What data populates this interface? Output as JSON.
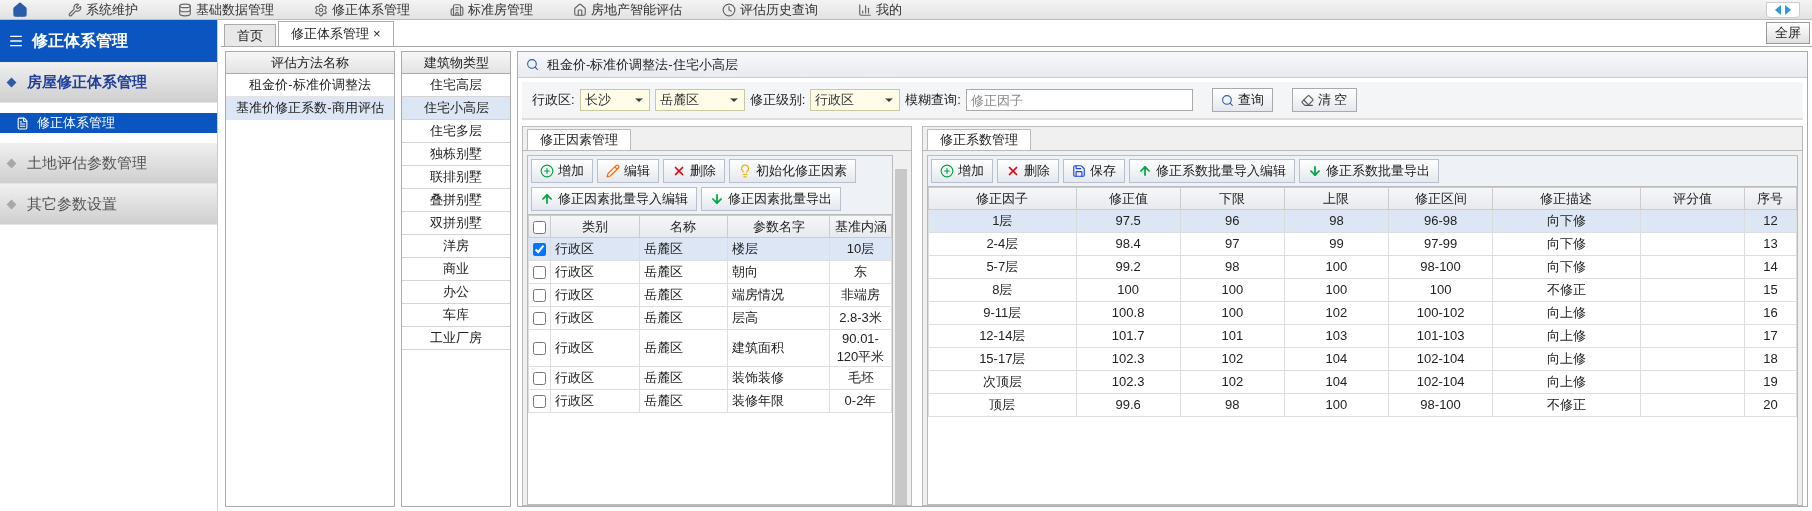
{
  "top_nav": [
    {
      "label": "系统维护"
    },
    {
      "label": "基础数据管理"
    },
    {
      "label": "修正体系管理"
    },
    {
      "label": "标准房管理"
    },
    {
      "label": "房地产智能评估"
    },
    {
      "label": "评估历史查询"
    },
    {
      "label": "我的"
    }
  ],
  "sidebar": {
    "title": "修正体系管理",
    "groups": [
      {
        "label": "房屋修正体系管理",
        "expanded": true,
        "items": [
          {
            "label": "修正体系管理",
            "selected": true
          }
        ]
      },
      {
        "label": "土地评估参数管理",
        "expanded": false
      },
      {
        "label": "其它参数设置",
        "expanded": false
      }
    ]
  },
  "tabs": [
    {
      "label": "首页",
      "selected": false,
      "closable": false
    },
    {
      "label": "修正体系管理",
      "selected": true,
      "closable": true,
      "close": "×"
    }
  ],
  "fullscreen_button": "全屏",
  "methods": {
    "header": "评估方法名称",
    "items": [
      {
        "label": "租金价-标准价调整法",
        "selected": false
      },
      {
        "label": "基准价修正系数-商用评估",
        "selected": true
      }
    ]
  },
  "building_types": {
    "header": "建筑物类型",
    "items": [
      {
        "label": "住宅高层",
        "selected": false
      },
      {
        "label": "住宅小高层",
        "selected": true
      },
      {
        "label": "住宅多层",
        "selected": false
      },
      {
        "label": "独栋别墅",
        "selected": false
      },
      {
        "label": "联排别墅",
        "selected": false
      },
      {
        "label": "叠拼别墅",
        "selected": false
      },
      {
        "label": "双拼别墅",
        "selected": false
      },
      {
        "label": "洋房",
        "selected": false
      },
      {
        "label": "商业",
        "selected": false
      },
      {
        "label": "办公",
        "selected": false
      },
      {
        "label": "车库",
        "selected": false
      },
      {
        "label": "工业厂房",
        "selected": false
      }
    ]
  },
  "panel_title": "租金价-标准价调整法-住宅小高层",
  "filters": {
    "region_label": "行政区:",
    "city": "长沙",
    "district": "岳麓区",
    "level_label": "修正级别:",
    "level": "行政区",
    "fuzzy_label": "模糊查询:",
    "fuzzy_placeholder": "修正因子",
    "search_button": "查询",
    "clear_button": "清 空"
  },
  "factors": {
    "tab": "修正因素管理",
    "buttons": [
      {
        "kind": "add",
        "label": "增加"
      },
      {
        "kind": "edit",
        "label": "编辑"
      },
      {
        "kind": "delete",
        "label": "删除"
      },
      {
        "kind": "bulb",
        "label": "初始化修正因素"
      },
      {
        "kind": "import",
        "label": "修正因素批量导入编辑"
      },
      {
        "kind": "export",
        "label": "修正因素批量导出"
      }
    ],
    "all_checked": false,
    "columns": [
      "类别",
      "名称",
      "参数名字",
      "基准内涵"
    ],
    "rows": [
      {
        "checked": true,
        "selected": true,
        "cells": [
          "行政区",
          "岳麓区",
          "楼层",
          "10层"
        ]
      },
      {
        "checked": false,
        "selected": false,
        "cells": [
          "行政区",
          "岳麓区",
          "朝向",
          "东"
        ]
      },
      {
        "checked": false,
        "selected": false,
        "cells": [
          "行政区",
          "岳麓区",
          "端房情况",
          "非端房"
        ]
      },
      {
        "checked": false,
        "selected": false,
        "cells": [
          "行政区",
          "岳麓区",
          "层高",
          "2.8-3米"
        ]
      },
      {
        "checked": false,
        "selected": false,
        "cells": [
          "行政区",
          "岳麓区",
          "建筑面积",
          "90.01-120平米"
        ]
      },
      {
        "checked": false,
        "selected": false,
        "cells": [
          "行政区",
          "岳麓区",
          "装饰装修",
          "毛坯"
        ]
      },
      {
        "checked": false,
        "selected": false,
        "cells": [
          "行政区",
          "岳麓区",
          "装修年限",
          "0-2年"
        ]
      }
    ]
  },
  "coefficients": {
    "tab": "修正系数管理",
    "buttons": [
      {
        "kind": "add",
        "label": "增加"
      },
      {
        "kind": "delete",
        "label": "删除"
      },
      {
        "kind": "save",
        "label": "保存"
      },
      {
        "kind": "import",
        "label": "修正系数批量导入编辑"
      },
      {
        "kind": "export",
        "label": "修正系数批量导出"
      }
    ],
    "columns": [
      "修正因子",
      "修正值",
      "下限",
      "上限",
      "修正区间",
      "修正描述",
      "评分值",
      "序号"
    ],
    "rows": [
      {
        "selected": true,
        "cells": [
          "1层",
          "97.5",
          "96",
          "98",
          "96-98",
          "向下修",
          "",
          "12"
        ]
      },
      {
        "selected": false,
        "cells": [
          "2-4层",
          "98.4",
          "97",
          "99",
          "97-99",
          "向下修",
          "",
          "13"
        ]
      },
      {
        "selected": false,
        "cells": [
          "5-7层",
          "99.2",
          "98",
          "100",
          "98-100",
          "向下修",
          "",
          "14"
        ]
      },
      {
        "selected": false,
        "cells": [
          "8层",
          "100",
          "100",
          "100",
          "100",
          "不修正",
          "",
          "15"
        ]
      },
      {
        "selected": false,
        "cells": [
          "9-11层",
          "100.8",
          "100",
          "102",
          "100-102",
          "向上修",
          "",
          "16"
        ]
      },
      {
        "selected": false,
        "cells": [
          "12-14层",
          "101.7",
          "101",
          "103",
          "101-103",
          "向上修",
          "",
          "17"
        ]
      },
      {
        "selected": false,
        "cells": [
          "15-17层",
          "102.3",
          "102",
          "104",
          "102-104",
          "向上修",
          "",
          "18"
        ]
      },
      {
        "selected": false,
        "cells": [
          "次顶层",
          "102.3",
          "102",
          "104",
          "102-104",
          "向上修",
          "",
          "19"
        ]
      },
      {
        "selected": false,
        "cells": [
          "顶层",
          "99.6",
          "98",
          "100",
          "98-100",
          "不修正",
          "",
          "20"
        ]
      }
    ]
  }
}
